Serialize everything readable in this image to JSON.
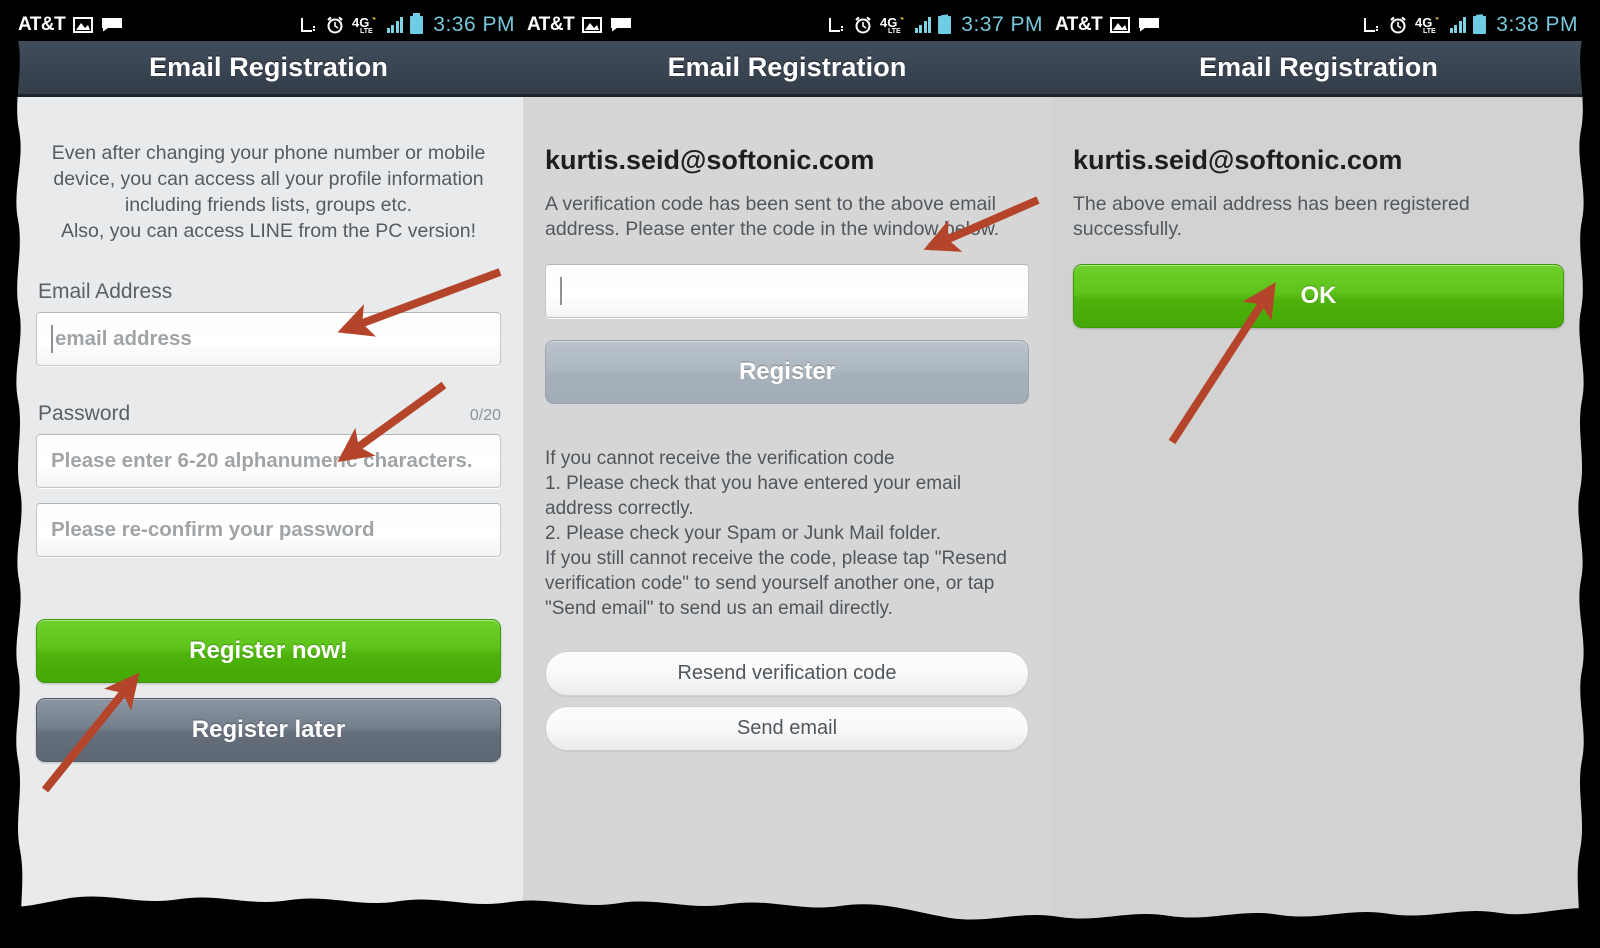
{
  "app": {
    "title": "Email Registration",
    "accent_green": "#55bf14",
    "accent_slate": "#6b7785",
    "titlebar_color": "#3a4553",
    "arrow_color": "#b5452a",
    "status_time_color": "#78c8dd"
  },
  "screens": [
    {
      "id": "registration-form",
      "statusbar": {
        "carrier": "AT&T",
        "time": "3:36 PM",
        "icons": [
          "sim-card-icon",
          "alarm-clock-icon",
          "4g-lte-icon",
          "signal-bars-icon",
          "battery-icon"
        ],
        "left_icons": [
          "gallery-icon",
          "message-icon"
        ]
      },
      "title": "Email Registration",
      "intro": "Even after changing your phone number or mobile device, you can access all your profile information including friends lists, groups etc.\nAlso, you can access LINE from the PC version!",
      "email_label": "Email Address",
      "email_placeholder": "email address",
      "password_label": "Password",
      "password_counter": "0/20",
      "password_placeholder": "Please enter 6-20 alphanumeric characters.",
      "password_confirm_placeholder": "Please re-confirm your password",
      "register_now_label": "Register now!",
      "register_later_label": "Register later"
    },
    {
      "id": "verification-code",
      "statusbar": {
        "carrier": "AT&T",
        "time": "3:37 PM",
        "icons": [
          "sim-card-icon",
          "alarm-clock-icon",
          "4g-lte-icon",
          "signal-bars-icon",
          "battery-icon"
        ],
        "left_icons": [
          "gallery-icon",
          "message-icon"
        ]
      },
      "title": "Email Registration",
      "email": "kurtis.seid@softonic.com",
      "instructions": "A verification code has been sent to the above email address. Please enter the code in the window below.",
      "code_value": "",
      "register_label": "Register",
      "help_text": "If you cannot receive the verification code\n1. Please check that you have entered your email address correctly.\n2. Please check your Spam or Junk Mail folder.\nIf you still cannot receive the code, please tap \"Resend verification code\" to send yourself another one, or tap \"Send email\" to send us an email directly.",
      "resend_label": "Resend verification code",
      "send_email_label": "Send email"
    },
    {
      "id": "registration-success",
      "statusbar": {
        "carrier": "AT&T",
        "time": "3:38 PM",
        "icons": [
          "sim-card-icon",
          "alarm-clock-icon",
          "4g-lte-icon",
          "signal-bars-icon",
          "battery-icon"
        ],
        "left_icons": [
          "gallery-icon",
          "message-icon"
        ]
      },
      "title": "Email Registration",
      "email": "kurtis.seid@softonic.com",
      "success_message": "The above email address has been registered successfully.",
      "ok_label": "OK"
    }
  ],
  "annotations": [
    {
      "name": "arrow-to-email-field",
      "target": "email address input"
    },
    {
      "name": "arrow-to-password-field",
      "target": "password input"
    },
    {
      "name": "arrow-to-register-now",
      "target": "Register now! button"
    },
    {
      "name": "arrow-to-code-field",
      "target": "verification code input"
    },
    {
      "name": "arrow-to-ok-button",
      "target": "OK button"
    }
  ]
}
